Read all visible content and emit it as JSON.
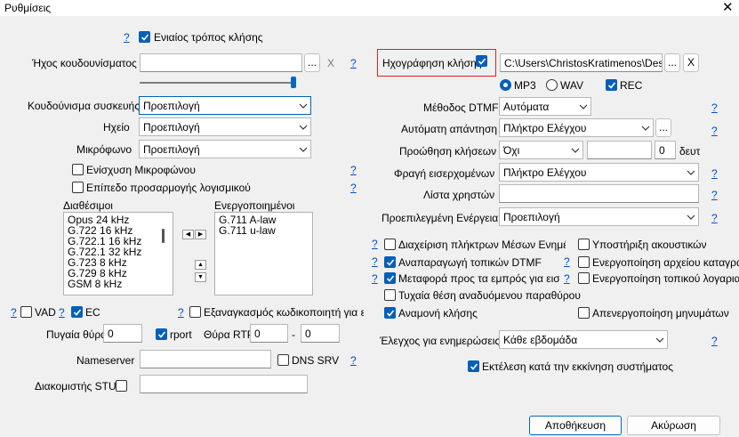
{
  "window": {
    "title": "Ρυθμίσεις",
    "close_glyph": "✕"
  },
  "help": "?",
  "unified": {
    "label": "Ενιαίος τρόπος κλήσης",
    "checked": true
  },
  "ringtone": {
    "label": "Ήχος κουδουνίσματος",
    "value": "",
    "browse": "...",
    "clear": "X"
  },
  "device_ring": {
    "label": "Κουδούνισμα συσκευής",
    "value": "Προεπιλογή"
  },
  "speaker": {
    "label": "Ηχείο",
    "value": "Προεπιλογή"
  },
  "mic": {
    "label": "Μικρόφωνο",
    "value": "Προεπιλογή"
  },
  "mic_boost": {
    "label": "Ενίσχυση Μικροφώνου",
    "checked": false
  },
  "software_adjust": {
    "label": "Επίπεδο προσαρμογής λογισμικού",
    "checked": false
  },
  "codecs": {
    "available_label": "Διαθέσιμοι",
    "enabled_label": "Ενεργοποιημένοι",
    "available": [
      "Opus 24 kHz",
      "G.722 16 kHz",
      "G.722.1 16 kHz",
      "G.722.1 32 kHz",
      "G.723 8 kHz",
      "G.729 8 kHz",
      "GSM 8 kHz"
    ],
    "enabled": [
      "G.711 A-law",
      "G.711 u-law"
    ]
  },
  "vad": {
    "label": "VAD",
    "checked": false
  },
  "ec": {
    "label": "EC",
    "checked": true
  },
  "force_codec": {
    "label": "Εξαναγκασμός κωδικοποιητή για εισερχ",
    "checked": false
  },
  "source_port": {
    "label": "Πυγαία θύρα",
    "value": "0"
  },
  "rport": {
    "label": "rport",
    "checked": true
  },
  "rtp_port": {
    "label": "Θύρα RTP",
    "from": "0",
    "dash": "-",
    "to": "0"
  },
  "nameserver": {
    "label": "Nameserver",
    "value": ""
  },
  "dns_srv": {
    "label": "DNS SRV",
    "checked": false
  },
  "stun": {
    "label": "Διακομιστής STUN",
    "checked": false,
    "value": ""
  },
  "recording": {
    "label": "Ηχογράφηση κλήσης",
    "checked": true,
    "path": "C:\\Users\\ChristosKratimenos\\Desktop",
    "browse": "...",
    "clear": "X"
  },
  "format": {
    "mp3": "MP3",
    "wav": "WAV",
    "rec": "REC",
    "selected": "MP3",
    "rec_checked": true
  },
  "dtmf": {
    "label": "Μέθοδος DTMF",
    "value": "Αυτόματα"
  },
  "auto_answer": {
    "label": "Αυτόματη απάντηση",
    "value": "Πλήκτρο Ελέγχου",
    "browse": "..."
  },
  "forwarding": {
    "label": "Προώθηση κλήσεων",
    "value": "Όχι",
    "target": "",
    "seconds": "0",
    "unit": "δευτ"
  },
  "block_incoming": {
    "label": "Φραγή εισερχομένων",
    "value": "Πλήκτρο Ελέγχου"
  },
  "user_list": {
    "label": "Λίστα χρηστών",
    "value": ""
  },
  "default_action": {
    "label": "Προεπιλεγμένη Ενέργεια",
    "value": "Προεπιλογή"
  },
  "options": {
    "media_keys": {
      "label": "Διαχείριση πλήκτρων Μέσων Ενημέρωσ",
      "checked": false
    },
    "headset": {
      "label": "Υποστήριξη ακουστικών",
      "checked": false
    },
    "local_dtmf": {
      "label": "Αναπαραγωγή τοπικών DTMF",
      "checked": true
    },
    "log_file": {
      "label": "Ενεργοποίηση αρχείου καταγραφή",
      "checked": false
    },
    "transfer": {
      "label": "Μεταφορά προς τα εμπρός για εισερχό",
      "checked": true
    },
    "local_account": {
      "label": "Ενεργοποίηση τοπικού λογαριασμο",
      "checked": false
    },
    "random_position": {
      "label": "Τυχαία θέση αναδυόμενου παραθύρου",
      "checked": false
    },
    "call_waiting": {
      "label": "Αναμονή κλήσης",
      "checked": true
    },
    "disable_messages": {
      "label": "Απενεργοποίηση μηνυμάτων",
      "checked": false
    }
  },
  "updates": {
    "label": "Έλεγχος για ενημερώσεις",
    "value": "Κάθε εβδομάδα"
  },
  "run_startup": {
    "label": "Εκτέλεση κατά την εκκίνηση συστήματος",
    "checked": true
  },
  "footer": {
    "save": "Αποθήκευση",
    "cancel": "Ακύρωση"
  },
  "colors": {
    "accent": "#005fb8",
    "link": "#0050c8",
    "highlight_border": "#e0201e",
    "background": "#f0f0f0"
  }
}
